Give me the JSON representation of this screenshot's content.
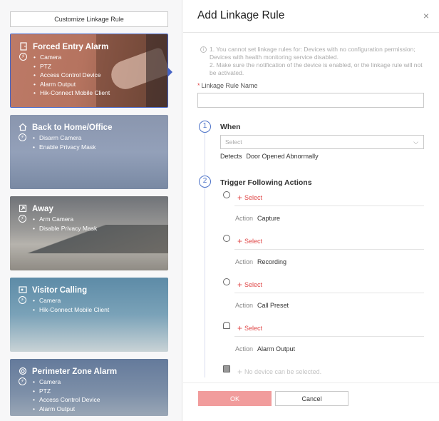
{
  "left": {
    "customize_label": "Customize Linkage Rule",
    "cards": [
      {
        "title": "Forced Entry Alarm",
        "items": [
          "Camera",
          "PTZ",
          "Access Control Device",
          "Alarm Output",
          "Hik-Connect Mobile Client"
        ]
      },
      {
        "title": "Back to Home/Office",
        "items": [
          "Disarm Camera",
          "Enable Privacy Mask"
        ]
      },
      {
        "title": "Away",
        "items": [
          "Arm Camera",
          "Disable Privacy Mask"
        ]
      },
      {
        "title": "Visitor Calling",
        "items": [
          "Camera",
          "Hik-Connect Mobile Client"
        ]
      },
      {
        "title": "Perimeter Zone Alarm",
        "items": [
          "Camera",
          "PTZ",
          "Access Control Device",
          "Alarm Output"
        ]
      }
    ]
  },
  "dialog": {
    "title": "Add Linkage Rule",
    "close_symbol": "×",
    "info_symbol": "i",
    "note_line1": "1. You cannot set linkage rules for: Devices with no configuration permission; Devices with health monitoring service disabled.",
    "note_line2": "2. Make sure the notification of the device is enabled, or the linkage rule will not be activated.",
    "required_mark": "*",
    "name_label": "Linkage Rule Name",
    "name_value": "",
    "step1_number": "1",
    "step1_title": "When",
    "when_placeholder": "Select",
    "detects_label": "Detects",
    "detects_value": "Door Opened Abnormally",
    "step2_number": "2",
    "step2_title": "Trigger Following Actions",
    "plus_symbol": "+",
    "select_label": "Select",
    "action_label": "Action",
    "actions": [
      {
        "value": "Capture"
      },
      {
        "value": "Recording"
      },
      {
        "value": "Call Preset"
      },
      {
        "value": "Alarm Output"
      }
    ],
    "disabled_text": "No device can be selected.",
    "ok_label": "OK",
    "cancel_label": "Cancel"
  }
}
